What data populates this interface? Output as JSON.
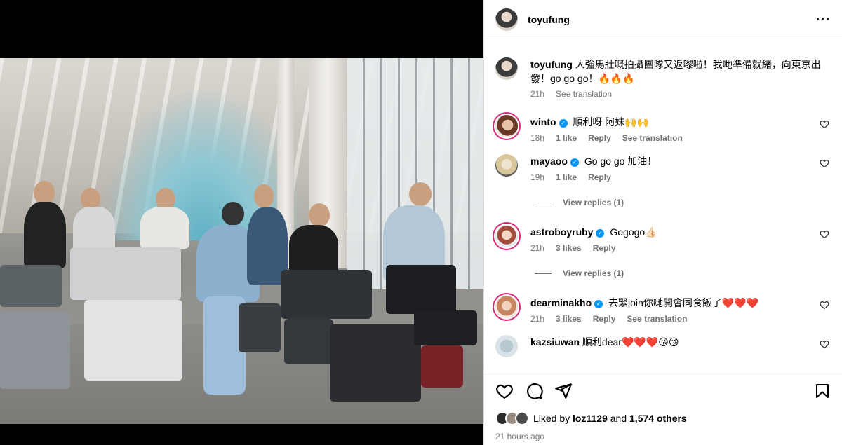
{
  "post": {
    "author": "toyufung"
  },
  "caption": {
    "username": "toyufung",
    "text": "人強馬壯嘅拍攝團隊又返嚟啦！我哋準備就緒，向東京出發！go go go！🔥🔥🔥",
    "time": "21h",
    "see_translation": "See translation"
  },
  "comments": [
    {
      "username": "winto",
      "verified": true,
      "text": "順利呀 阿妹🙌🙌",
      "time": "18h",
      "likes": "1 like",
      "reply": "Reply",
      "see_translation": "See translation"
    },
    {
      "username": "mayaoo",
      "verified": true,
      "text": "Go go go 加油！",
      "time": "19h",
      "likes": "1 like",
      "reply": "Reply",
      "view_replies": "View replies (1)"
    },
    {
      "username": "astroboyruby",
      "verified": true,
      "text": "Gogogo👍🏻",
      "time": "21h",
      "likes": "3 likes",
      "reply": "Reply",
      "view_replies": "View replies (1)"
    },
    {
      "username": "dearminakho",
      "verified": true,
      "text": "去緊join你哋開會同食飯了❤️❤️❤️",
      "time": "21h",
      "likes": "3 likes",
      "reply": "Reply",
      "see_translation": "See translation"
    },
    {
      "username": "kazsiuwan",
      "verified": false,
      "text": "順利dear❤️❤️❤️😘😘"
    }
  ],
  "actions": {
    "liked_by_prefix": "Liked by",
    "liked_by_user": "loz1129",
    "and": "and",
    "others": "1,574 others",
    "posted": "21 hours ago"
  },
  "icons": [
    "more-options-icon",
    "like-icon",
    "comment-icon",
    "share-icon",
    "save-icon",
    "heart-icon",
    "verified-icon"
  ],
  "colors": {
    "verified": "#0095f6",
    "story_ring": "#d62976",
    "meta_gray": "#737373"
  }
}
